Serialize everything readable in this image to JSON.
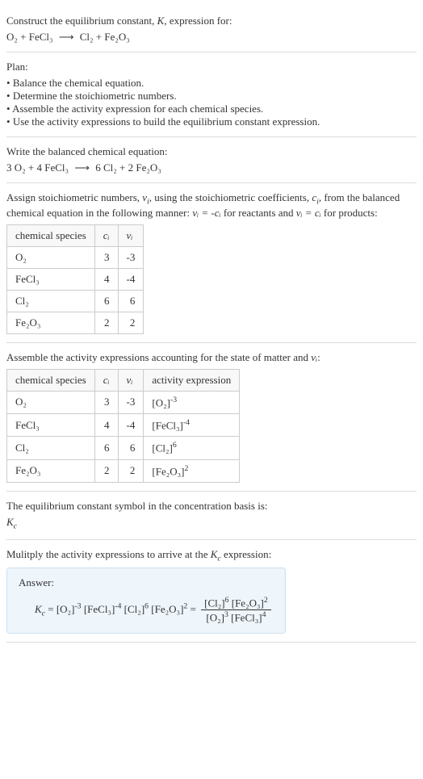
{
  "intro": {
    "line1": "Construct the equilibrium constant, ",
    "k": "K",
    "line1b": ", expression for:",
    "eq_left": "O₂ + FeCl₃",
    "arrow": "⟶",
    "eq_right": "Cl₂ + Fe₂O₃"
  },
  "plan": {
    "header": "Plan:",
    "items": [
      "Balance the chemical equation.",
      "Determine the stoichiometric numbers.",
      "Assemble the activity expression for each chemical species.",
      "Use the activity expressions to build the equilibrium constant expression."
    ]
  },
  "balanced": {
    "header": "Write the balanced chemical equation:",
    "eq_left": "3 O₂ + 4 FeCl₃",
    "arrow": "⟶",
    "eq_right": "6 Cl₂ + 2 Fe₂O₃"
  },
  "assign": {
    "text1": "Assign stoichiometric numbers, ",
    "nu": "ν",
    "sub_i": "i",
    "text2": ", using the stoichiometric coefficients, ",
    "c": "c",
    "text3": ", from the balanced chemical equation in the following manner: ",
    "rel1": "νᵢ = -cᵢ",
    "text4": " for reactants and ",
    "rel2": "νᵢ = cᵢ",
    "text5": " for products:",
    "table": {
      "headers": [
        "chemical species",
        "cᵢ",
        "νᵢ"
      ],
      "rows": [
        [
          "O₂",
          "3",
          "-3"
        ],
        [
          "FeCl₃",
          "4",
          "-4"
        ],
        [
          "Cl₂",
          "6",
          "6"
        ],
        [
          "Fe₂O₃",
          "2",
          "2"
        ]
      ]
    }
  },
  "activity": {
    "text1": "Assemble the activity expressions accounting for the state of matter and ",
    "nu": "νᵢ",
    "text2": ":",
    "table": {
      "headers": [
        "chemical species",
        "cᵢ",
        "νᵢ",
        "activity expression"
      ],
      "rows": [
        {
          "species": "O₂",
          "c": "3",
          "v": "-3",
          "base": "[O₂]",
          "exp": "-3"
        },
        {
          "species": "FeCl₃",
          "c": "4",
          "v": "-4",
          "base": "[FeCl₃]",
          "exp": "-4"
        },
        {
          "species": "Cl₂",
          "c": "6",
          "v": "6",
          "base": "[Cl₂]",
          "exp": "6"
        },
        {
          "species": "Fe₂O₃",
          "c": "2",
          "v": "2",
          "base": "[Fe₂O₃]",
          "exp": "2"
        }
      ]
    }
  },
  "symbol": {
    "text": "The equilibrium constant symbol in the concentration basis is:",
    "kc": "K",
    "kc_sub": "c"
  },
  "multiply": {
    "text1": "Mulitply the activity expressions to arrive at the ",
    "kc": "K",
    "kc_sub": "c",
    "text2": " expression:"
  },
  "answer": {
    "label": "Answer:",
    "lhs_k": "K",
    "lhs_sub": "c",
    "eq": " = ",
    "terms": [
      {
        "base": "[O₂]",
        "exp": "-3"
      },
      {
        "base": "[FeCl₃]",
        "exp": "-4"
      },
      {
        "base": "[Cl₂]",
        "exp": "6"
      },
      {
        "base": "[Fe₂O₃]",
        "exp": "2"
      }
    ],
    "frac_num": [
      {
        "base": "[Cl₂]",
        "exp": "6"
      },
      {
        "base": "[Fe₂O₃]",
        "exp": "2"
      }
    ],
    "frac_den": [
      {
        "base": "[O₂]",
        "exp": "3"
      },
      {
        "base": "[FeCl₃]",
        "exp": "4"
      }
    ]
  }
}
